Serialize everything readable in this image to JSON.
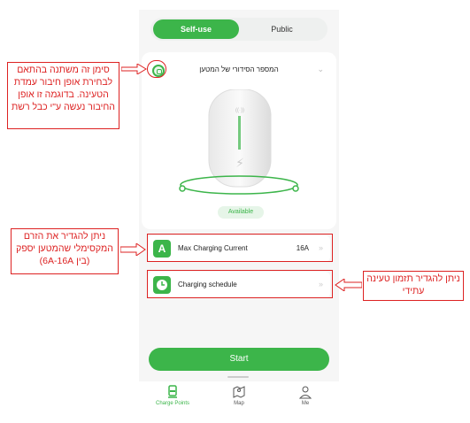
{
  "segment": {
    "self_use": "Self-use",
    "public": "Public"
  },
  "device": {
    "title": "המספר הסידורי של המטען",
    "status": "Available",
    "icon": "plug-icon"
  },
  "settings": {
    "max_current": {
      "icon_letter": "A",
      "label": "Max Charging Current",
      "value": "16A"
    },
    "schedule": {
      "label": "Charging schedule"
    }
  },
  "start_label": "Start",
  "tabs": [
    {
      "label": "Charge Points",
      "icon": "charger-icon"
    },
    {
      "label": "Map",
      "icon": "map-icon"
    },
    {
      "label": "Me",
      "icon": "person-icon"
    }
  ],
  "annotations": {
    "icon_note": "סימן זה משתנה בהתאם לבחירת אופן חיבור עמדת הטעינה. בדוגמה זו אופן החיבור נעשה ע\"י כבל רשת",
    "current_note": "ניתן להגדיר את הזרם המקסימלי שהמטען יספק (בין 6A-16A)",
    "schedule_note": "ניתן להגדיר תזמון טעינה עתידי"
  },
  "colors": {
    "accent": "#3cb54a",
    "annotation": "#dd2222"
  }
}
